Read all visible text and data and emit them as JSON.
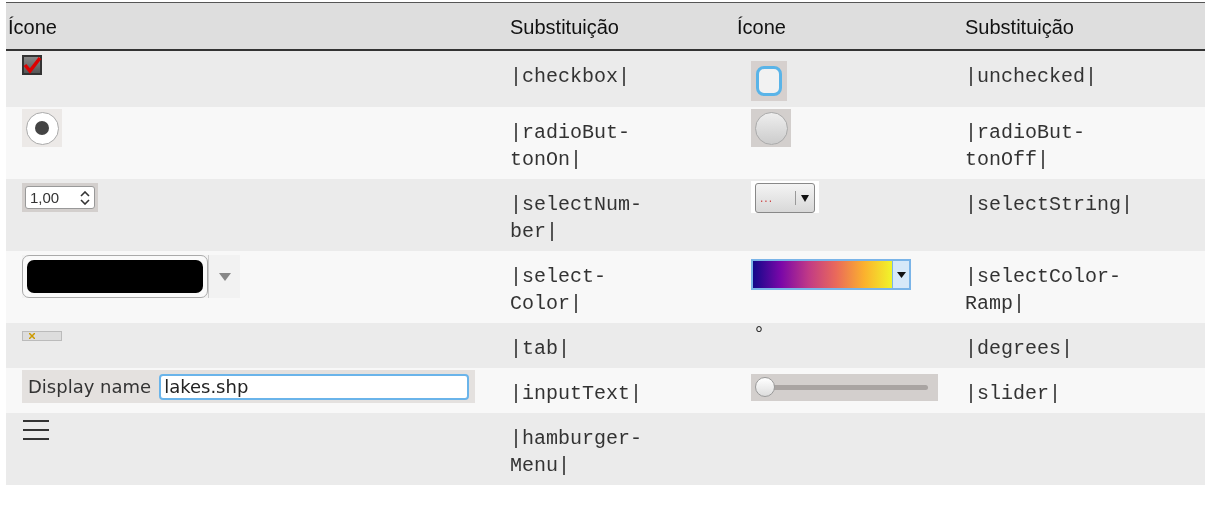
{
  "table": {
    "columns": [
      "Ícone",
      "Substituição",
      "Ícone",
      "Substituição"
    ],
    "rows": [
      {
        "cells": [
          {
            "icon": {
              "kind": "checkbox",
              "checked": true
            }
          },
          "|checkbox|",
          {
            "icon": {
              "kind": "checkbox",
              "checked": false
            }
          },
          "|unchecked|"
        ]
      },
      {
        "cells": [
          {
            "icon": {
              "kind": "radio",
              "checked": true
            }
          },
          "|radioBut-tonOn|",
          {
            "icon": {
              "kind": "radio",
              "checked": false
            }
          },
          "|radioBut-tonOff|"
        ]
      },
      {
        "cells": [
          {
            "icon": {
              "kind": "spinbox",
              "value": "1,00"
            }
          },
          "|selectNum-ber|",
          {
            "icon": {
              "kind": "stringselect",
              "value": "..."
            }
          },
          "|selectString|"
        ]
      },
      {
        "cells": [
          {
            "icon": {
              "kind": "colorbutton"
            }
          },
          "|select-Color|",
          {
            "icon": {
              "kind": "colorramp"
            }
          },
          "|selectColor-Ramp|"
        ]
      },
      {
        "cells": [
          {
            "icon": {
              "kind": "tab"
            }
          },
          "|tab|",
          {
            "icon": {
              "kind": "symbol",
              "text": "°"
            }
          },
          "|degrees|"
        ]
      },
      {
        "cells": [
          {
            "icon": {
              "kind": "textinput",
              "label": "Display name",
              "value": "lakes.shp"
            }
          },
          "|inputText|",
          {
            "icon": {
              "kind": "slider",
              "level": 0
            }
          },
          "|slider|"
        ]
      },
      {
        "cells": [
          {
            "icon": {
              "kind": "menu"
            }
          },
          "|hamburger-Menu|"
        ]
      }
    ]
  }
}
